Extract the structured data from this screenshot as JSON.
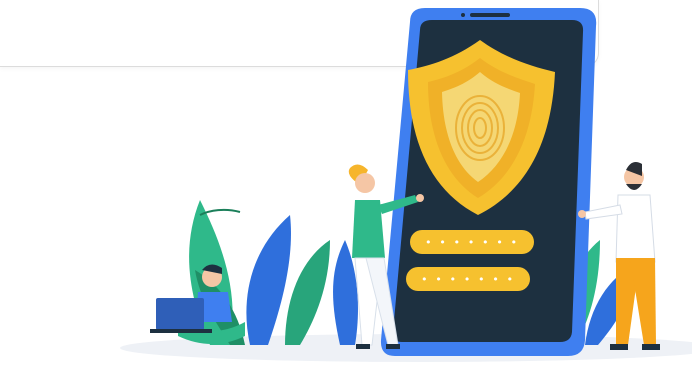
{
  "illustration": {
    "password_fields": [
      {
        "mask": "• • • • • • •"
      },
      {
        "mask": "• • • • • • •"
      }
    ]
  },
  "colors": {
    "phone_body": "#3f7ff0",
    "phone_screen": "#1d3040",
    "shield_outer": "#f6c12f",
    "shield_inner": "#f5d774",
    "field": "#f6c12f",
    "leaf_green": "#2fb98a",
    "leaf_blue": "#2f6fdc"
  }
}
